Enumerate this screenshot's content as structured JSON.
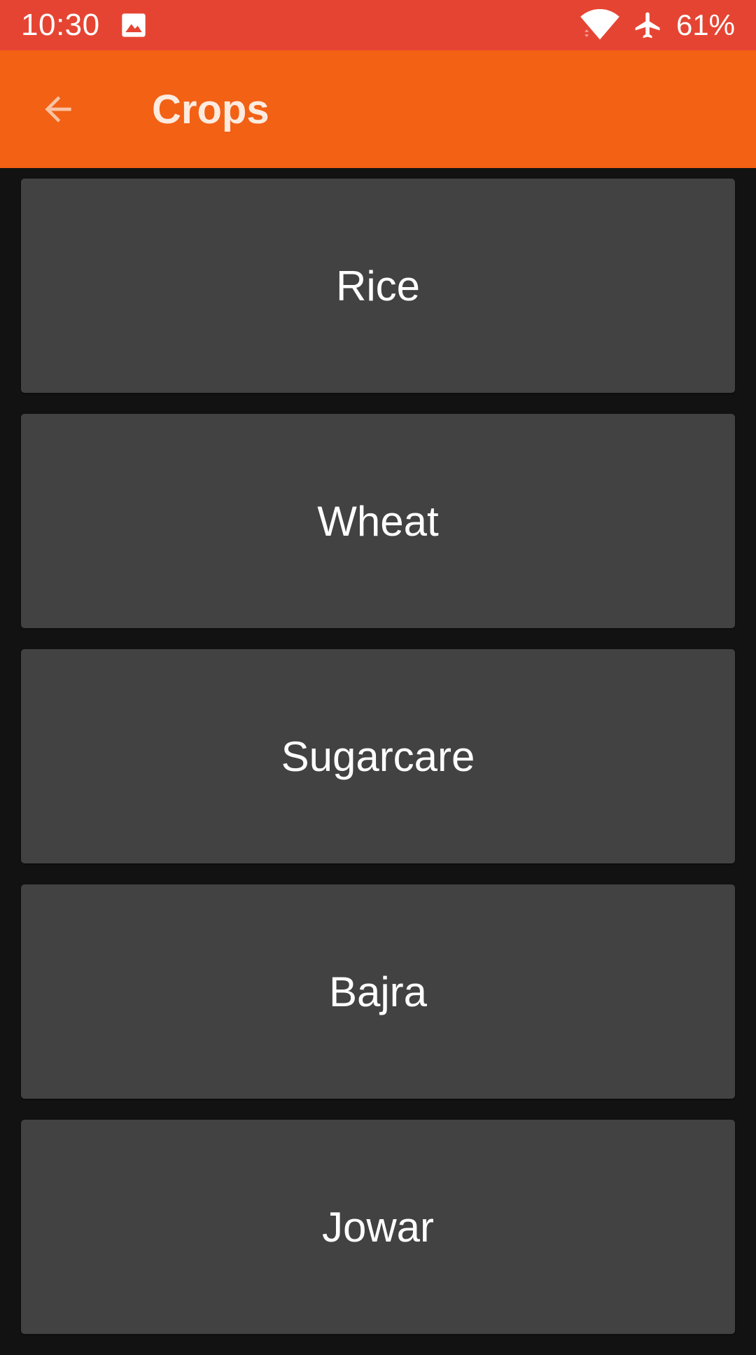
{
  "status_bar": {
    "time": "10:30",
    "battery": "61%",
    "icons": [
      "image-icon",
      "wifi-icon",
      "airplane-icon"
    ]
  },
  "app_bar": {
    "title": "Crops",
    "back_icon": "arrow-back-icon"
  },
  "crops": [
    {
      "label": "Rice"
    },
    {
      "label": "Wheat"
    },
    {
      "label": "Sugarcare"
    },
    {
      "label": "Bajra"
    },
    {
      "label": "Jowar"
    }
  ],
  "colors": {
    "status_bar": "#e64433",
    "app_bar": "#f26114",
    "background": "#121212",
    "card": "#424242"
  }
}
